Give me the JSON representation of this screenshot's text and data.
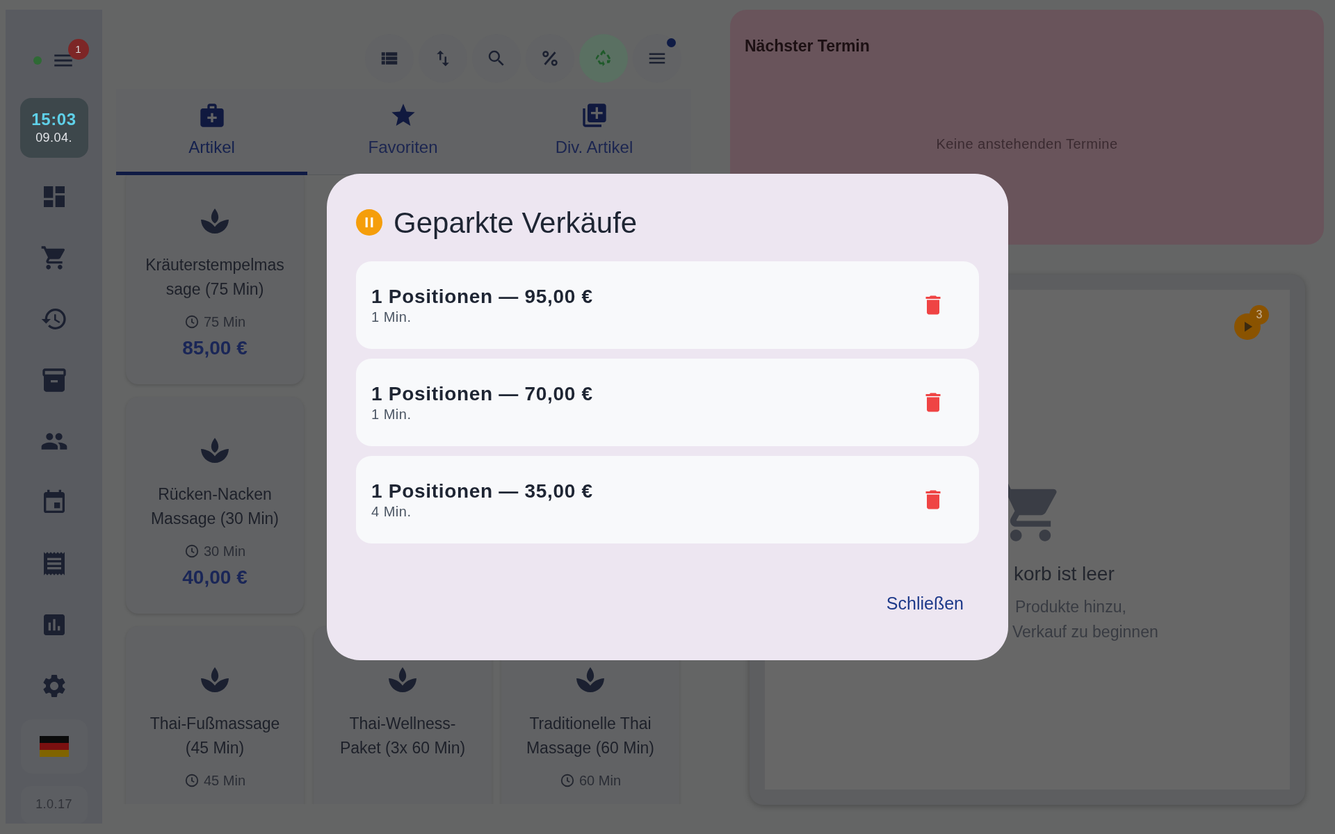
{
  "sidebar": {
    "online": true,
    "menu_badge": "1",
    "clock": {
      "time": "15:03",
      "date": "09.04."
    },
    "version": "1.0.17"
  },
  "toolbar_buttons": [
    {
      "active": false,
      "dot": false
    },
    {
      "active": false,
      "dot": false
    },
    {
      "active": false,
      "dot": false
    },
    {
      "active": false,
      "dot": false
    },
    {
      "active": true,
      "dot": false
    },
    {
      "active": false,
      "dot": true
    }
  ],
  "tabs": [
    {
      "label": "Artikel",
      "selected": true
    },
    {
      "label": "Favoriten",
      "selected": false
    },
    {
      "label": "Div. Artikel",
      "selected": false
    }
  ],
  "products": [
    {
      "name": "Kräuterstempelmassage (75 Min)",
      "duration": "75 Min",
      "price": "85,00 €"
    },
    {
      "name": "Rücken-Nacken Massage (30 Min)",
      "duration": "30 Min",
      "price": "40,00 €"
    },
    {
      "name": "Thai-Fußmassage (45 Min)",
      "duration": "45 Min"
    },
    {
      "name": "Thai-Wellness-Paket (3x 60 Min)"
    },
    {
      "name": "Traditionelle Thai Massage (60 Min)",
      "duration": "60 Min"
    }
  ],
  "appointments": {
    "title": "Nächster Termin",
    "empty_text": "Keine anstehenden Termine"
  },
  "cart": {
    "parked_count": "3",
    "title": "korb ist leer",
    "hint_lines": [
      "Produkte hinzu,",
      "Verkauf zu beginnen"
    ]
  },
  "dialog": {
    "title": "Geparkte Verkäufe",
    "items": [
      {
        "summary": "1 Positionen — 95,00 €",
        "age": "1 Min."
      },
      {
        "summary": "1 Positionen — 70,00 €",
        "age": "1 Min."
      },
      {
        "summary": "1 Positionen — 35,00 €",
        "age": "4 Min."
      }
    ],
    "close_label": "Schließen"
  }
}
